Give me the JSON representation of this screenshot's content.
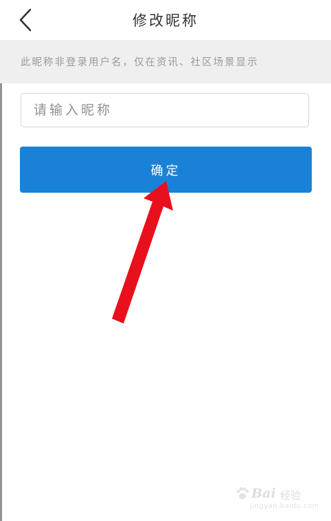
{
  "header": {
    "title": "修改昵称",
    "back_icon": "chevron-left-icon"
  },
  "notice": {
    "text": "此昵称非登录用户名，仅在资讯、社区场景显示"
  },
  "form": {
    "nickname_placeholder": "请输入昵称",
    "nickname_value": "",
    "confirm_label": "确定"
  },
  "colors": {
    "primary": "#1a82d6",
    "banner_bg": "#efefef",
    "annotation_arrow": "#e8101c"
  },
  "watermark": {
    "brand": "Bai",
    "brand_suffix": "经验",
    "url": "jingyan.baidu.com"
  }
}
